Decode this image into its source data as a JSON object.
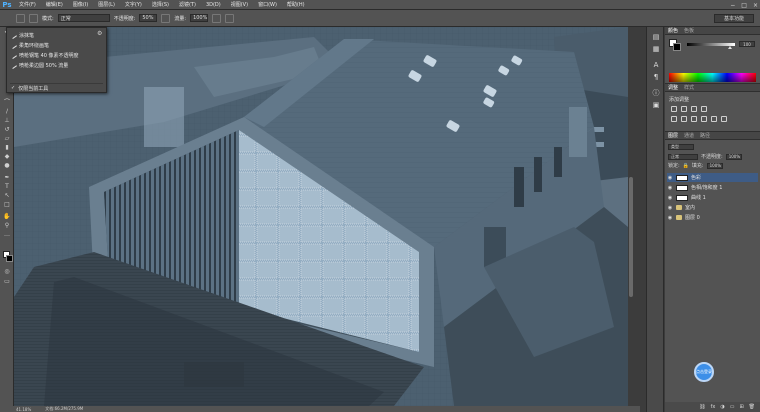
{
  "app": {
    "logo": "Ps"
  },
  "menu": [
    "文件(F)",
    "编辑(E)",
    "图像(I)",
    "图层(L)",
    "文字(Y)",
    "选择(S)",
    "滤镜(T)",
    "3D(D)",
    "视图(V)",
    "窗口(W)",
    "帮助(H)"
  ],
  "window_controls": [
    "−",
    "□",
    "×"
  ],
  "options": {
    "mode_label": "模式:",
    "mode_value": "正常",
    "opacity_label": "不透明度:",
    "opacity_value": "50%",
    "flow_label": "流量:",
    "flow_value": "100%",
    "workspace": "基本功能"
  },
  "tool_preset_menu": {
    "items": [
      "涂抹笔",
      "柔角环绕画笔",
      "喷枪钢笔 40 像素不透明度",
      "喷枪柔边圆 50% 流量"
    ],
    "footer": "仅限当前工具"
  },
  "status": {
    "zoom": "41.18%",
    "doc": "文档:66.2M/275.9M"
  },
  "color_panel": {
    "tabs": [
      "颜色",
      "色板"
    ],
    "k_value": "100",
    "k_fill": 0.9,
    "foreground": "#ffffff",
    "background": "#000000"
  },
  "adjustments_panel": {
    "tabs": [
      "调整",
      "样式"
    ],
    "title": "添加调整"
  },
  "layers_panel": {
    "tabs": [
      "图层",
      "通道",
      "路径"
    ],
    "kind_label": "类型",
    "blend_mode": "正常",
    "opacity_label": "不透明度:",
    "opacity_value": "100%",
    "lock_label": "锁定:",
    "fill_label": "填充:",
    "fill_value": "100%",
    "layers": [
      {
        "name": "色彩",
        "selected": true
      },
      {
        "name": "色相/饱和度 1",
        "selected": false
      },
      {
        "name": "曲线 1",
        "selected": false
      },
      {
        "name": "室内",
        "selected": false
      },
      {
        "name": "图层 0",
        "selected": false
      }
    ]
  },
  "badge": {
    "label": "点击登录"
  },
  "colors": {
    "accent": "#3e5c86",
    "panel": "#535353",
    "badge": "#3d8fe8"
  }
}
